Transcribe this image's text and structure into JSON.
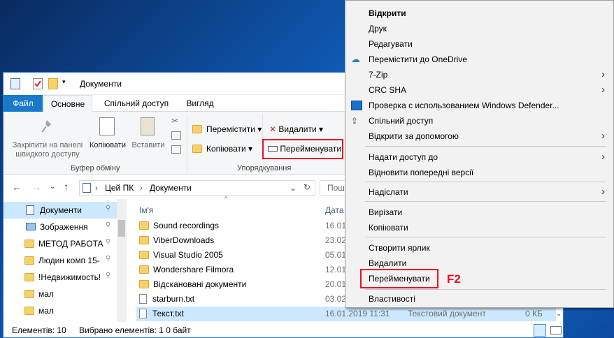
{
  "window": {
    "title": "Документи"
  },
  "tabs": {
    "file": "Файл",
    "home": "Основне",
    "share": "Спільний доступ",
    "view": "Вигляд"
  },
  "ribbon": {
    "pin_l1": "Закріпити на панелі",
    "pin_l2": "швидкого доступу",
    "copy": "Копіювати",
    "paste": "Вставити",
    "clipboard_group": "Буфер обміну",
    "move": "Перемістити",
    "copy_to": "Копіювати",
    "delete": "Видалити",
    "rename": "Перейменувати",
    "organize_group": "Упорядкування"
  },
  "address": {
    "pc": "Цей ПК",
    "folder": "Документи",
    "search": "Пош"
  },
  "nav": [
    "Документи",
    "Зображення",
    "МЕТОД РАБОТА",
    "Людин комп 15-",
    "!Недвижимость!",
    "мал",
    "мал"
  ],
  "columns": {
    "name": "Ім'я",
    "date": "Дата"
  },
  "files": [
    {
      "name": "Sound recordings",
      "date": "16.01"
    },
    {
      "name": "ViberDownloads",
      "date": "23.02"
    },
    {
      "name": "Visual Studio 2005",
      "date": "05.01"
    },
    {
      "name": "Wondershare Filmora",
      "date": "12.01"
    },
    {
      "name": "Відскановані документи",
      "date": "20.01"
    },
    {
      "name": "starburn.txt",
      "date": "03.02"
    },
    {
      "name": "Текст.txt",
      "date": "16.01.2019 11:31",
      "type": "Текстовий документ",
      "size": "0 КБ"
    }
  ],
  "status": {
    "count": "Елементів: 10",
    "selected": "Вибрано елементів: 1  0 байт"
  },
  "menu": {
    "open": "Відкрити",
    "print": "Друк",
    "edit": "Редагувати",
    "onedrive": "Перемістити до OneDrive",
    "zip": "7-Zip",
    "crc": "CRC SHA",
    "defender": "Проверка с использованием Windows Defender...",
    "share": "Спільний доступ",
    "open_with": "Відкрити за допомогою",
    "give_access": "Надати доступ до",
    "restore": "Відновити попередні версії",
    "send_to": "Надіслати",
    "cut": "Вирізати",
    "copy": "Копіювати",
    "shortcut": "Створити ярлик",
    "delete": "Видалити",
    "rename": "Перейменувати",
    "properties": "Властивості"
  },
  "hint": "F2",
  "colors": {
    "accent": "#1979ca",
    "highlight": "#e81123",
    "selection": "#cce8ff"
  }
}
